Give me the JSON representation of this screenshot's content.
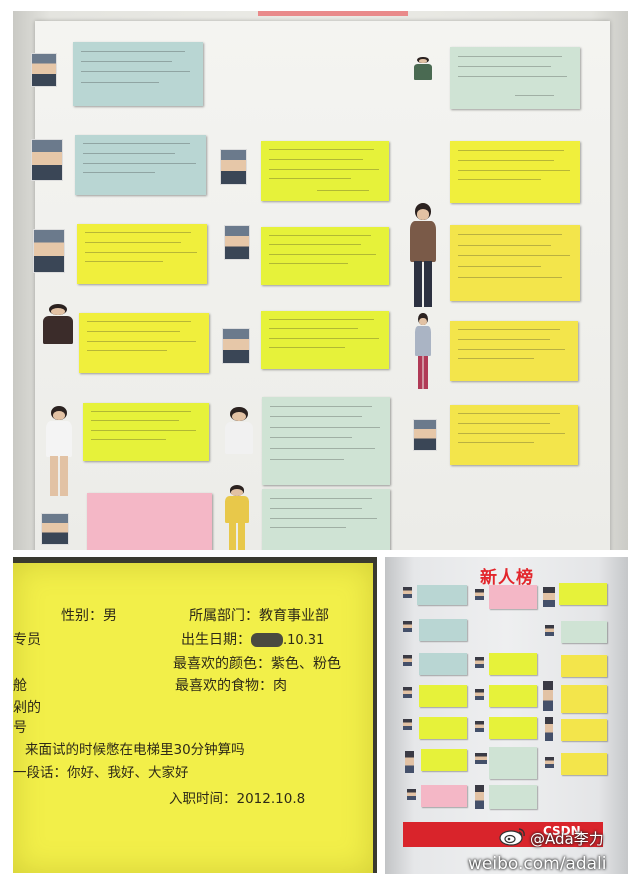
{
  "closeup": {
    "gender": "性别：男",
    "department": "所属部门：教育事业部",
    "role_fragment": "专员",
    "birth": "出生日期：",
    "birth_tail": ".10.31",
    "fav_color": "最喜欢的颜色：紫色、粉色",
    "fav_food": "最喜欢的食物：肉",
    "frag_1": "舱",
    "frag_2": "剁的",
    "frag_3": "号",
    "question": "来面试的时候憋在电梯里30分钟算吗",
    "greeting": "一段话：你好、我好、大家好",
    "join_date": "入职时间：2012.10.8"
  },
  "overview": {
    "banner": "新人榜",
    "logo": "CSDN"
  },
  "watermark": {
    "handle": "@Ada李力",
    "url": "weibo.com/adali"
  }
}
